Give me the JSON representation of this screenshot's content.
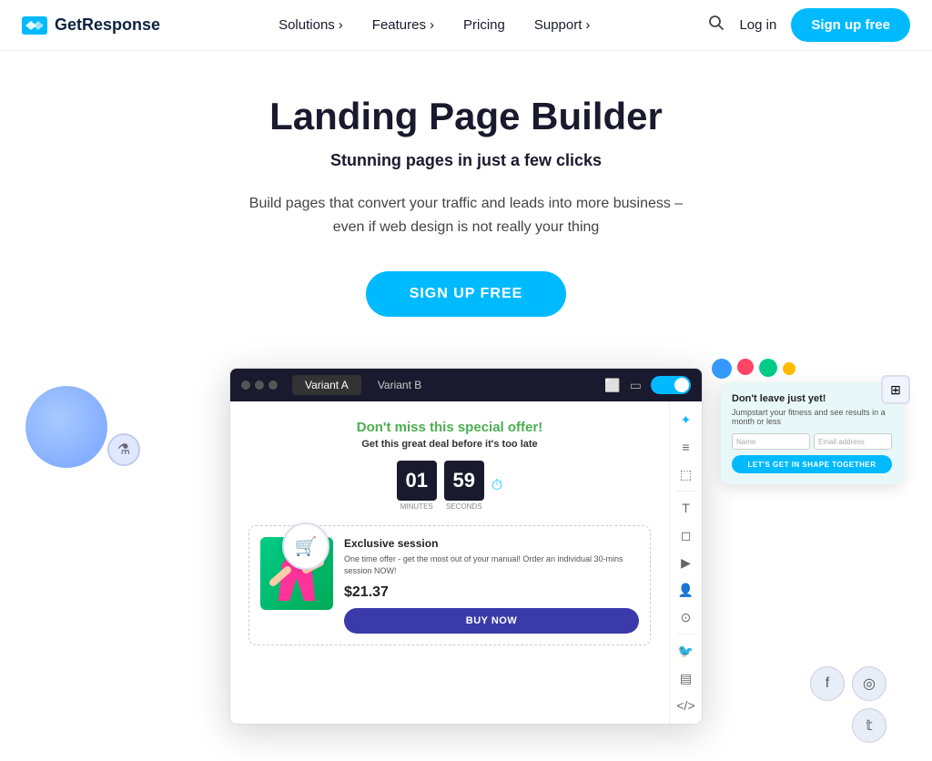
{
  "brand": {
    "name": "GetResponse",
    "logo_alt": "GetResponse logo"
  },
  "nav": {
    "solutions_label": "Solutions",
    "features_label": "Features",
    "pricing_label": "Pricing",
    "support_label": "Support",
    "login_label": "Log in",
    "signup_label": "Sign up free"
  },
  "hero": {
    "title": "Landing Page Builder",
    "subtitle": "Stunning pages in just a few clicks",
    "description": "Build pages that convert your traffic and leads into more business – even if web design is not really your thing",
    "cta_label": "SIGN UP FREE"
  },
  "demo": {
    "tab_a": "Variant A",
    "tab_b": "Variant B",
    "offer_title": "Don't miss this special offer!",
    "offer_subtitle": "Get this great deal before it's too late",
    "countdown_minutes": "01",
    "countdown_seconds": "59",
    "countdown_minutes_label": "MINUTES",
    "countdown_seconds_label": "SECONDS",
    "product_title": "Exclusive session",
    "product_desc": "One time offer - get the most out of your manual! Order an individual 30-mins session NOW!",
    "product_price": "$21.37",
    "product_btn": "BUY NOW",
    "popup_title": "Don't leave just yet!",
    "popup_subtitle": "Jumpstart your fitness and see results in a month or less",
    "popup_name_placeholder": "Name",
    "popup_email_placeholder": "Email address",
    "popup_btn": "LET'S GET IN SHAPE TOGETHER"
  },
  "colors": {
    "brand": "#00baff",
    "dark": "#1a1a2e",
    "green": "#4caf50"
  }
}
